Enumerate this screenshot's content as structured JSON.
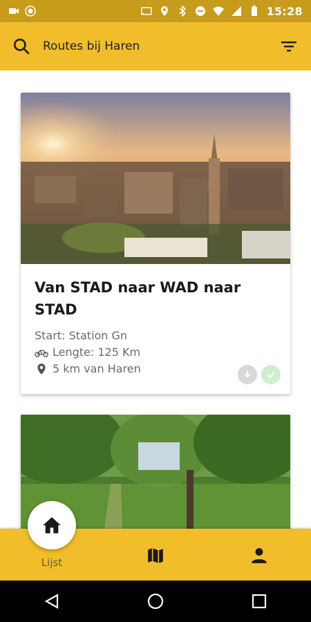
{
  "status_bar": {
    "time": "15:28",
    "color": "#c79b1c"
  },
  "app_bar": {
    "title": "Routes bij Haren",
    "search_icon": "search-icon",
    "filter_icon": "filter-icon",
    "color": "#f2bd2a"
  },
  "routes": [
    {
      "title": "Van STAD naar WAD naar STAD",
      "start": "Start: Station Gn",
      "length": "Lengte: 125 Km",
      "distance": "5 km van Haren",
      "image": "city-skyline-photo"
    },
    {
      "image": "green-path-photo"
    }
  ],
  "bottom_nav": {
    "items": [
      {
        "label": "Lijst",
        "icon": "home-icon",
        "active": true
      },
      {
        "label": "",
        "icon": "map-icon"
      },
      {
        "label": "",
        "icon": "profile-icon"
      }
    ]
  },
  "system_nav": {
    "icons": [
      "back-icon",
      "home-circle-icon",
      "recents-icon"
    ]
  }
}
